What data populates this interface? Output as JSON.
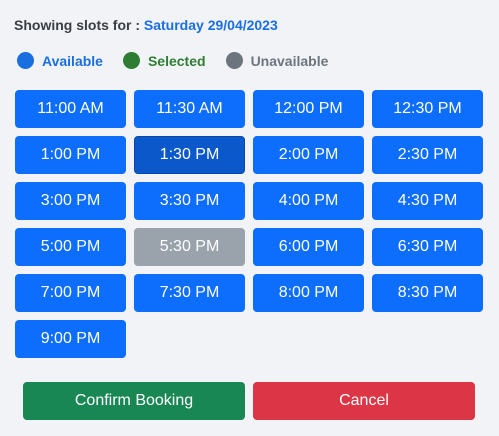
{
  "header": {
    "label": "Showing slots for :",
    "date": "Saturday 29/04/2023"
  },
  "legend": [
    {
      "label": "Available",
      "color": "#1a6fe0",
      "name": "available"
    },
    {
      "label": "Selected",
      "color": "#2e7d32",
      "name": "selected"
    },
    {
      "label": "Unavailable",
      "color": "#6c757d",
      "name": "unavailable"
    }
  ],
  "colors": {
    "available": "#0d6efd",
    "selected": "#0a58ca",
    "unavailable": "#9aa3ab",
    "confirm": "#198754",
    "cancel": "#dc3545"
  },
  "slots": [
    {
      "time": "11:00 AM",
      "status": "available"
    },
    {
      "time": "11:30 AM",
      "status": "available"
    },
    {
      "time": "12:00 PM",
      "status": "available"
    },
    {
      "time": "12:30 PM",
      "status": "available"
    },
    {
      "time": "1:00 PM",
      "status": "available"
    },
    {
      "time": "1:30 PM",
      "status": "selected"
    },
    {
      "time": "2:00 PM",
      "status": "available"
    },
    {
      "time": "2:30 PM",
      "status": "available"
    },
    {
      "time": "3:00 PM",
      "status": "available"
    },
    {
      "time": "3:30 PM",
      "status": "available"
    },
    {
      "time": "4:00 PM",
      "status": "available"
    },
    {
      "time": "4:30 PM",
      "status": "available"
    },
    {
      "time": "5:00 PM",
      "status": "available"
    },
    {
      "time": "5:30 PM",
      "status": "unavailable"
    },
    {
      "time": "6:00 PM",
      "status": "available"
    },
    {
      "time": "6:30 PM",
      "status": "available"
    },
    {
      "time": "7:00 PM",
      "status": "available"
    },
    {
      "time": "7:30 PM",
      "status": "available"
    },
    {
      "time": "8:00 PM",
      "status": "available"
    },
    {
      "time": "8:30 PM",
      "status": "available"
    },
    {
      "time": "9:00 PM",
      "status": "available"
    }
  ],
  "actions": {
    "confirm_label": "Confirm Booking",
    "cancel_label": "Cancel"
  }
}
